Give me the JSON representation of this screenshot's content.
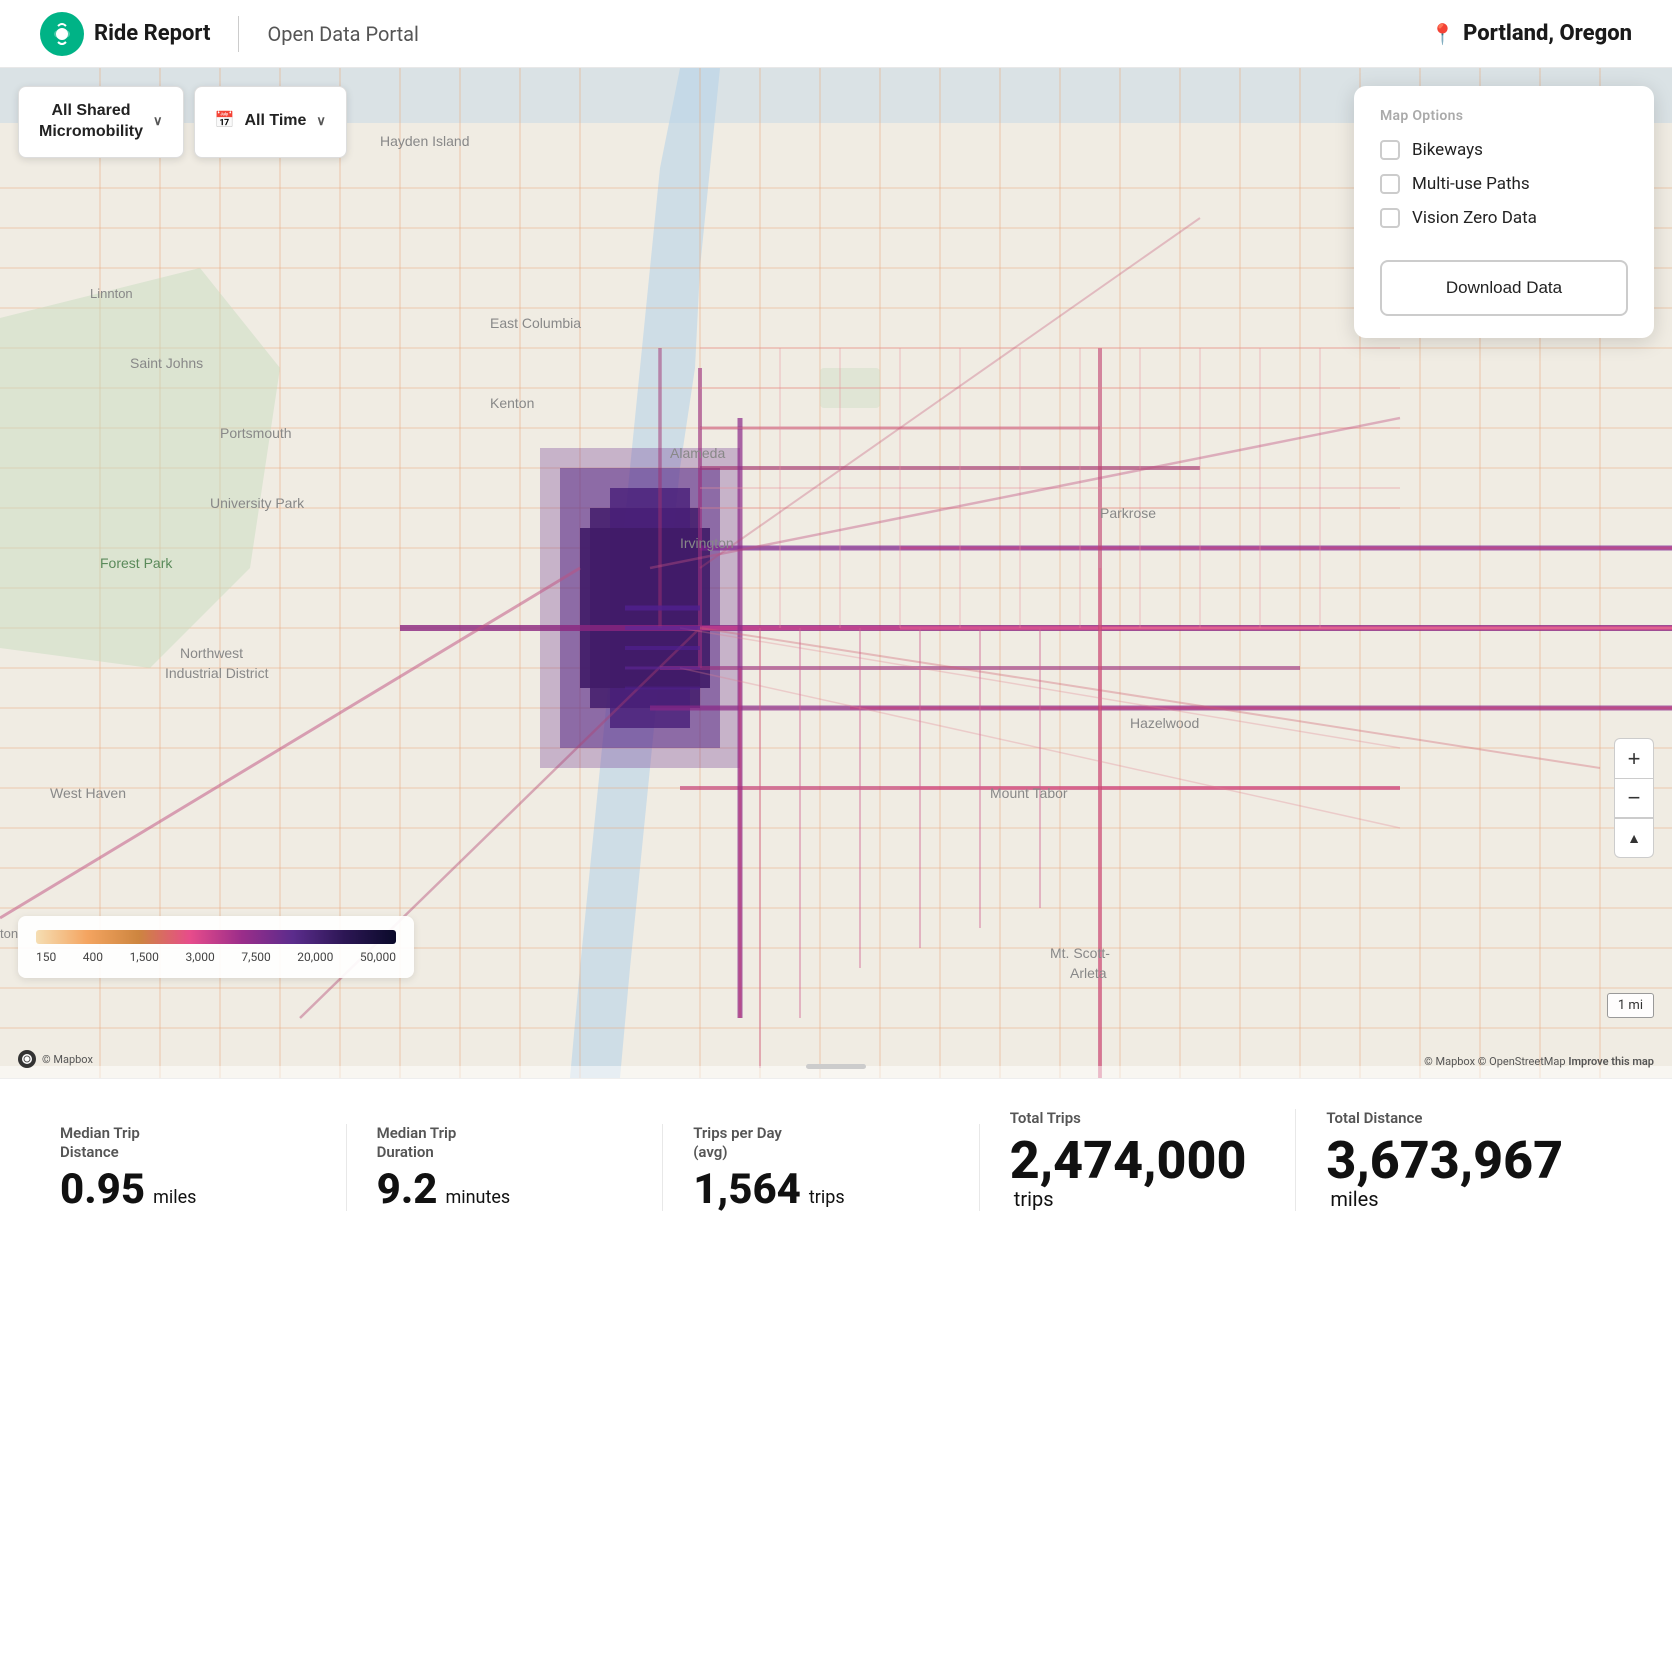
{
  "header": {
    "logo_text": "Ride Report",
    "portal_text": "Open Data Portal",
    "location": "Portland, Oregon"
  },
  "controls": {
    "mobility_label": "All Shared\nMicromobility",
    "time_label": "All Time",
    "chevron": "∨"
  },
  "map_options": {
    "title": "Map Options",
    "options": [
      {
        "label": "Bikeways",
        "checked": false
      },
      {
        "label": "Multi-use Paths",
        "checked": false
      },
      {
        "label": "Vision Zero Data",
        "checked": false
      }
    ],
    "download_label": "Download Data"
  },
  "legend": {
    "values": [
      "150",
      "400",
      "1,500",
      "3,000",
      "7,500",
      "20,000",
      "50,000"
    ]
  },
  "map": {
    "attribution": "© Mapbox © OpenStreetMap",
    "improve_text": "Improve this map",
    "mapbox_credit": "© Mapbox",
    "scale_label": "1 mi"
  },
  "zoom": {
    "plus": "+",
    "minus": "−",
    "compass": "▲"
  },
  "stats": [
    {
      "label": "Median Trip Distance",
      "value": "0.95",
      "unit": "miles"
    },
    {
      "label": "Median Trip Duration",
      "value": "9.2",
      "unit": "minutes"
    },
    {
      "label": "Trips per Day (avg)",
      "value": "1,564",
      "unit": "trips"
    },
    {
      "label": "Total Trips",
      "value": "2,474,000",
      "unit": "trips"
    },
    {
      "label": "Total Distance",
      "value": "3,673,967",
      "unit": "miles"
    }
  ]
}
